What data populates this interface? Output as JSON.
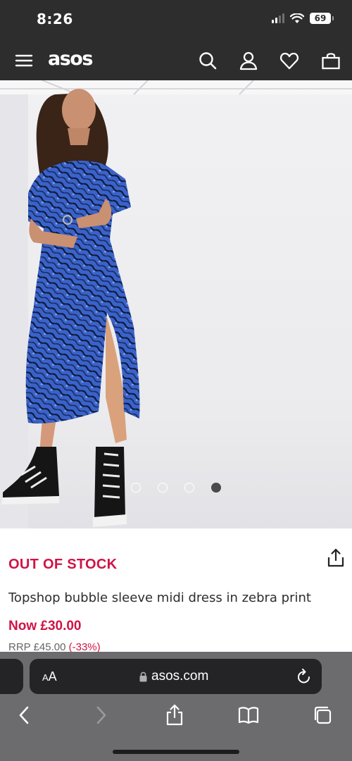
{
  "status_bar": {
    "time": "8:26",
    "battery": "69"
  },
  "header": {
    "logo": "asos",
    "icons": [
      "menu-icon",
      "search-icon",
      "account-icon",
      "heart-icon",
      "bag-icon"
    ]
  },
  "gallery": {
    "image_count": 4,
    "active_index": 3
  },
  "product": {
    "stock_status": "OUT OF STOCK",
    "title": "Topshop bubble sleeve midi dress in zebra print",
    "price": "Now £30.00",
    "rrp": "RRP £45.00",
    "discount": "(-33%)"
  },
  "browser": {
    "aa_label": "AA",
    "url": "asos.com"
  },
  "colors": {
    "header_bg": "#2d2d2d",
    "sale_red": "#d01345",
    "safari_bar": "#6c6c6e",
    "dress_blue": "#3a63c9"
  }
}
